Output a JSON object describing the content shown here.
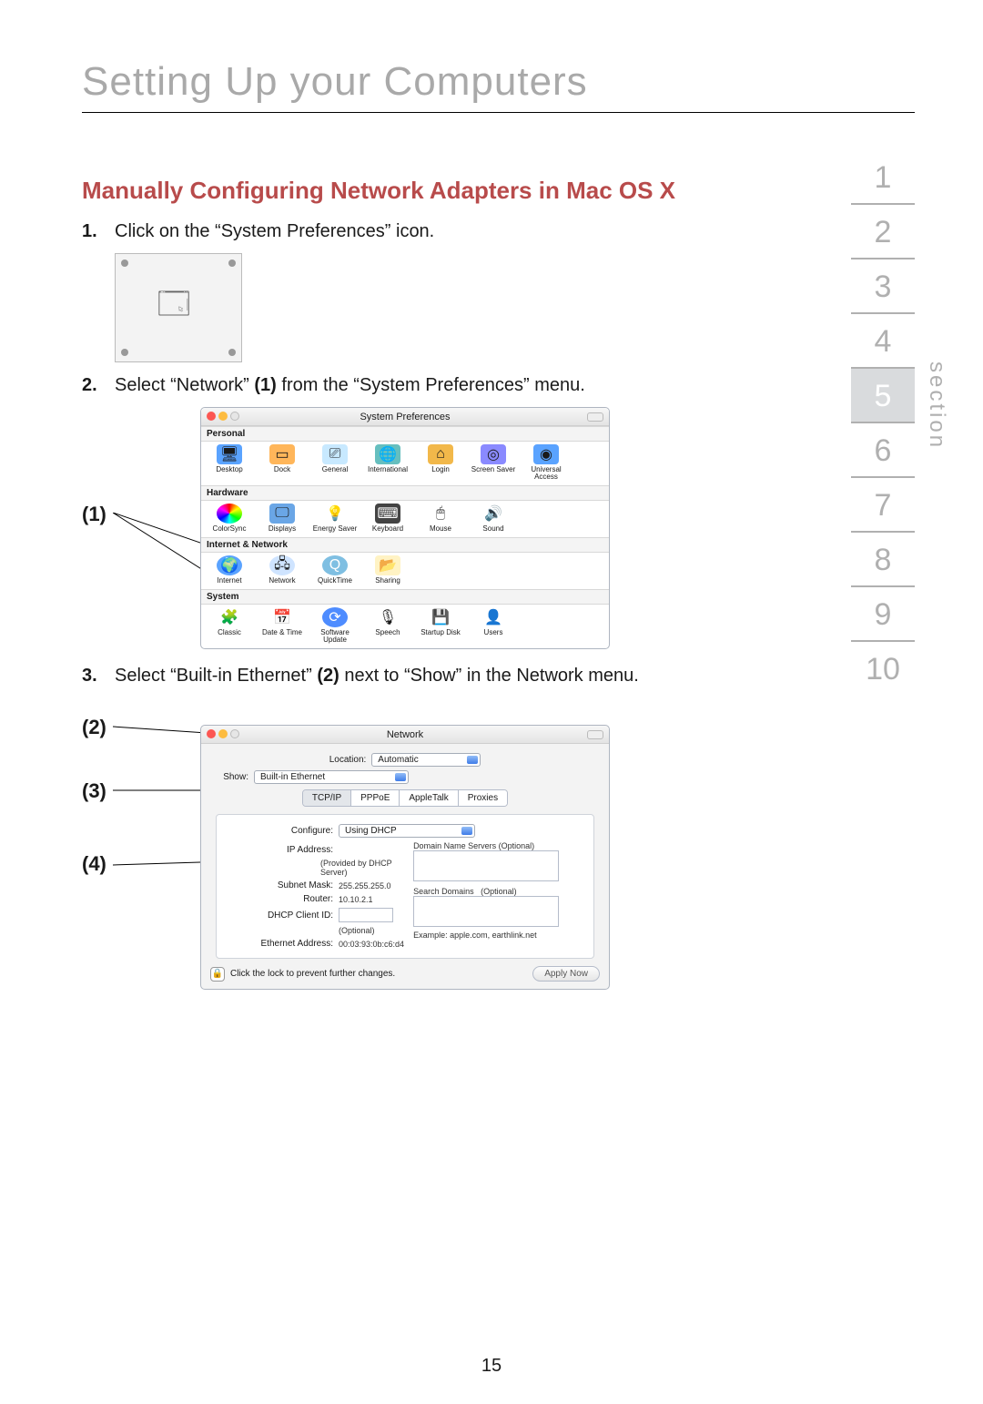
{
  "page_title": "Setting Up your Computers",
  "page_number": "15",
  "section": {
    "label": "section",
    "items": [
      "1",
      "2",
      "3",
      "4",
      "5",
      "6",
      "7",
      "8",
      "9",
      "10"
    ],
    "active_index": 4
  },
  "heading": "Manually Configuring Network Adapters in Mac OS X",
  "steps": {
    "s1": "Click on the “System Preferences” icon.",
    "s2_a": "Select “Network” ",
    "s2_b": "(1)",
    "s2_c": " from the “System Preferences” menu.",
    "s3_a": "Select “Built-in Ethernet” ",
    "s3_b": "(2)",
    "s3_c": " next to “Show” in the Network menu."
  },
  "sysprefs": {
    "window_title": "System Preferences",
    "cats": {
      "personal": {
        "label": "Personal",
        "items": [
          "Desktop",
          "Dock",
          "General",
          "International",
          "Login",
          "Screen Saver",
          "Universal Access"
        ]
      },
      "hardware": {
        "label": "Hardware",
        "items": [
          "ColorSync",
          "Displays",
          "Energy Saver",
          "Keyboard",
          "Mouse",
          "Sound"
        ]
      },
      "internet": {
        "label": "Internet & Network",
        "items": [
          "Internet",
          "Network",
          "QuickTime",
          "Sharing"
        ]
      },
      "system": {
        "label": "System",
        "items": [
          "Classic",
          "Date & Time",
          "Software Update",
          "Speech",
          "Startup Disk",
          "Users"
        ]
      }
    }
  },
  "callouts": {
    "c1": "(1)",
    "c2": "(2)",
    "c3": "(3)",
    "c4": "(4)"
  },
  "network": {
    "window_title": "Network",
    "location_label": "Location:",
    "location_value": "Automatic",
    "show_label": "Show:",
    "show_value": "Built-in Ethernet",
    "tabs": [
      "TCP/IP",
      "PPPoE",
      "AppleTalk",
      "Proxies"
    ],
    "active_tab": 0,
    "configure_label": "Configure:",
    "configure_value": "Using DHCP",
    "ip_label": "IP Address:",
    "ip_hint": "(Provided by DHCP Server)",
    "subnet_label": "Subnet Mask:",
    "subnet_value": "255.255.255.0",
    "router_label": "Router:",
    "router_value": "10.10.2.1",
    "dhcp_label": "DHCP Client ID:",
    "dhcp_hint": "(Optional)",
    "eth_label": "Ethernet Address:",
    "eth_value": "00:03:93:0b:c6:d4",
    "dns_label": "Domain Name Servers",
    "dns_opt": "(Optional)",
    "search_label": "Search Domains",
    "search_opt": "(Optional)",
    "example": "Example: apple.com, earthlink.net",
    "lock_text": "Click the lock to prevent further changes.",
    "apply": "Apply Now"
  }
}
